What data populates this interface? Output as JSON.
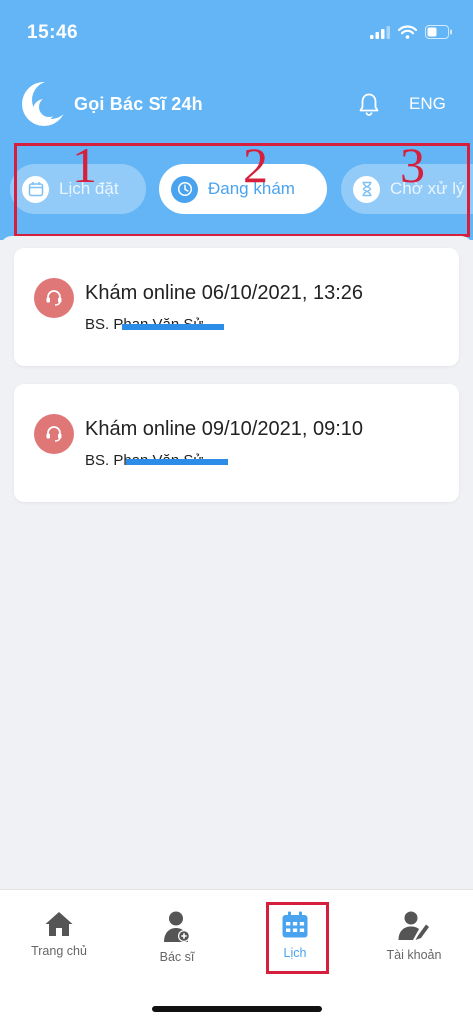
{
  "status_bar": {
    "time": "15:46"
  },
  "header": {
    "app_title": "Gọi Bác Sĩ 24h",
    "language": "ENG"
  },
  "tabs": [
    {
      "label": "Lịch đặt",
      "icon": "calendar-icon",
      "active": false
    },
    {
      "label": "Đang khám",
      "icon": "clock-icon",
      "active": true
    },
    {
      "label": "Chờ xử lý",
      "icon": "hourglass-icon",
      "active": false
    }
  ],
  "annotations": {
    "tab_numbers": [
      "1",
      "2",
      "3"
    ]
  },
  "appointments": [
    {
      "title": "Khám online 06/10/2021, 13:26",
      "doctor": "BS. Phan Văn Sử",
      "icon": "headset-icon"
    },
    {
      "title": "Khám online 09/10/2021, 09:10",
      "doctor": "BS. Phan Văn Sử",
      "icon": "headset-icon"
    }
  ],
  "bottom_nav": [
    {
      "label": "Trang chủ",
      "icon": "home-icon",
      "active": false
    },
    {
      "label": "Bác sĩ",
      "icon": "doctor-icon",
      "active": false
    },
    {
      "label": "Lịch",
      "icon": "calendar-icon",
      "active": true
    },
    {
      "label": "Tài khoản",
      "icon": "account-icon",
      "active": false
    }
  ],
  "colors": {
    "header": "#63b5f5",
    "accent": "#4aa3ee",
    "annotation": "#d61f3c",
    "avatar": "#e07777",
    "redaction": "#2b8de8"
  }
}
